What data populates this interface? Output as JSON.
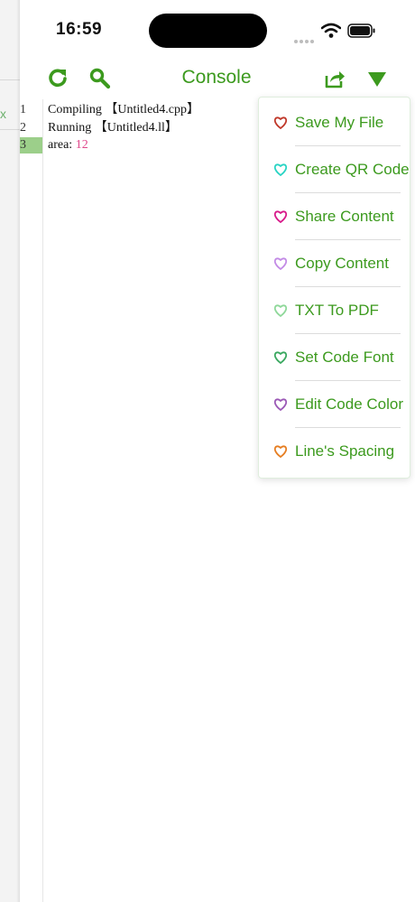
{
  "status_bar": {
    "time": "16:59"
  },
  "left_panel": {
    "close_label": "x"
  },
  "toolbar": {
    "title": "Console",
    "accent_color": "#3c9a1e",
    "icons": [
      "refresh-icon",
      "search-icon",
      "share-icon",
      "dropdown-triangle-icon"
    ]
  },
  "console": {
    "lines": [
      {
        "num": "1",
        "text": "Compiling 【Untitled4.cpp】"
      },
      {
        "num": "2",
        "text": "Running 【Untitled4.ll】"
      },
      {
        "num": "3",
        "label": "area: ",
        "value": "12"
      }
    ],
    "active_line_color": "#9ccf8a",
    "value_color": "#e0468a"
  },
  "menu": {
    "items": [
      {
        "label": "Save My File",
        "heart_color": "#c0392b"
      },
      {
        "label": "Create QR Code",
        "heart_color": "#2ad4c4"
      },
      {
        "label": "Share Content",
        "heart_color": "#d81b8a"
      },
      {
        "label": "Copy Content",
        "heart_color": "#c38be6"
      },
      {
        "label": "TXT To PDF",
        "heart_color": "#8fd89a"
      },
      {
        "label": "Set Code Font",
        "heart_color": "#3aa860"
      },
      {
        "label": "Edit Code Color",
        "heart_color": "#9b59b6"
      },
      {
        "label": "Line's Spacing",
        "heart_color": "#e67e22"
      }
    ]
  }
}
